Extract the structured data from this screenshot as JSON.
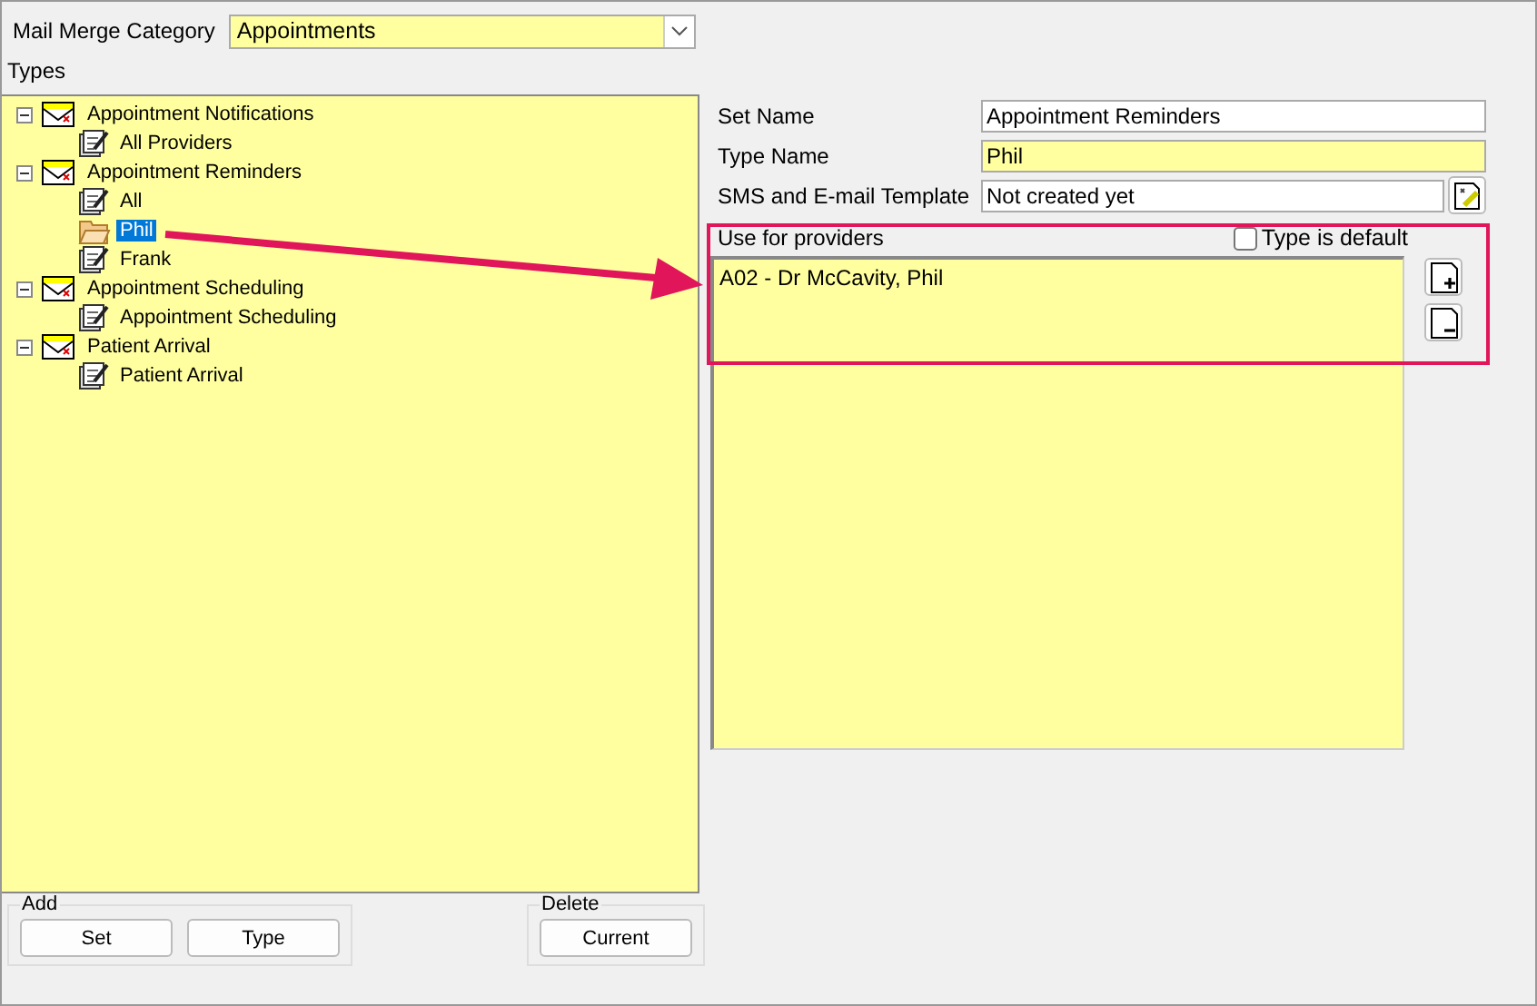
{
  "category": {
    "label": "Mail Merge Category",
    "value": "Appointments"
  },
  "types": {
    "label": "Types",
    "tree": [
      {
        "label": "Appointment Notifications",
        "expanded": true,
        "children": [
          {
            "label": "All Providers",
            "selected": false
          }
        ]
      },
      {
        "label": "Appointment Reminders",
        "expanded": true,
        "children": [
          {
            "label": "All",
            "selected": false
          },
          {
            "label": "Phil",
            "selected": true
          },
          {
            "label": "Frank",
            "selected": false
          }
        ]
      },
      {
        "label": "Appointment Scheduling",
        "expanded": true,
        "children": [
          {
            "label": "Appointment Scheduling",
            "selected": false
          }
        ]
      },
      {
        "label": "Patient Arrival",
        "expanded": true,
        "children": [
          {
            "label": "Patient Arrival",
            "selected": false
          }
        ]
      }
    ]
  },
  "details": {
    "set_name": {
      "label": "Set Name",
      "value": "Appointment Reminders"
    },
    "type_name": {
      "label": "Type Name",
      "value": "Phil"
    },
    "template": {
      "label": "SMS and E-mail Template",
      "value": "Not created yet"
    },
    "providers_label": "Use for providers",
    "type_default": {
      "label": "Type is default",
      "checked": false
    },
    "providers": [
      "A02 - Dr McCavity, Phil"
    ]
  },
  "add_group": {
    "label": "Add",
    "buttons": [
      "Set",
      "Type"
    ]
  },
  "delete_group": {
    "label": "Delete",
    "buttons": [
      "Current"
    ]
  }
}
